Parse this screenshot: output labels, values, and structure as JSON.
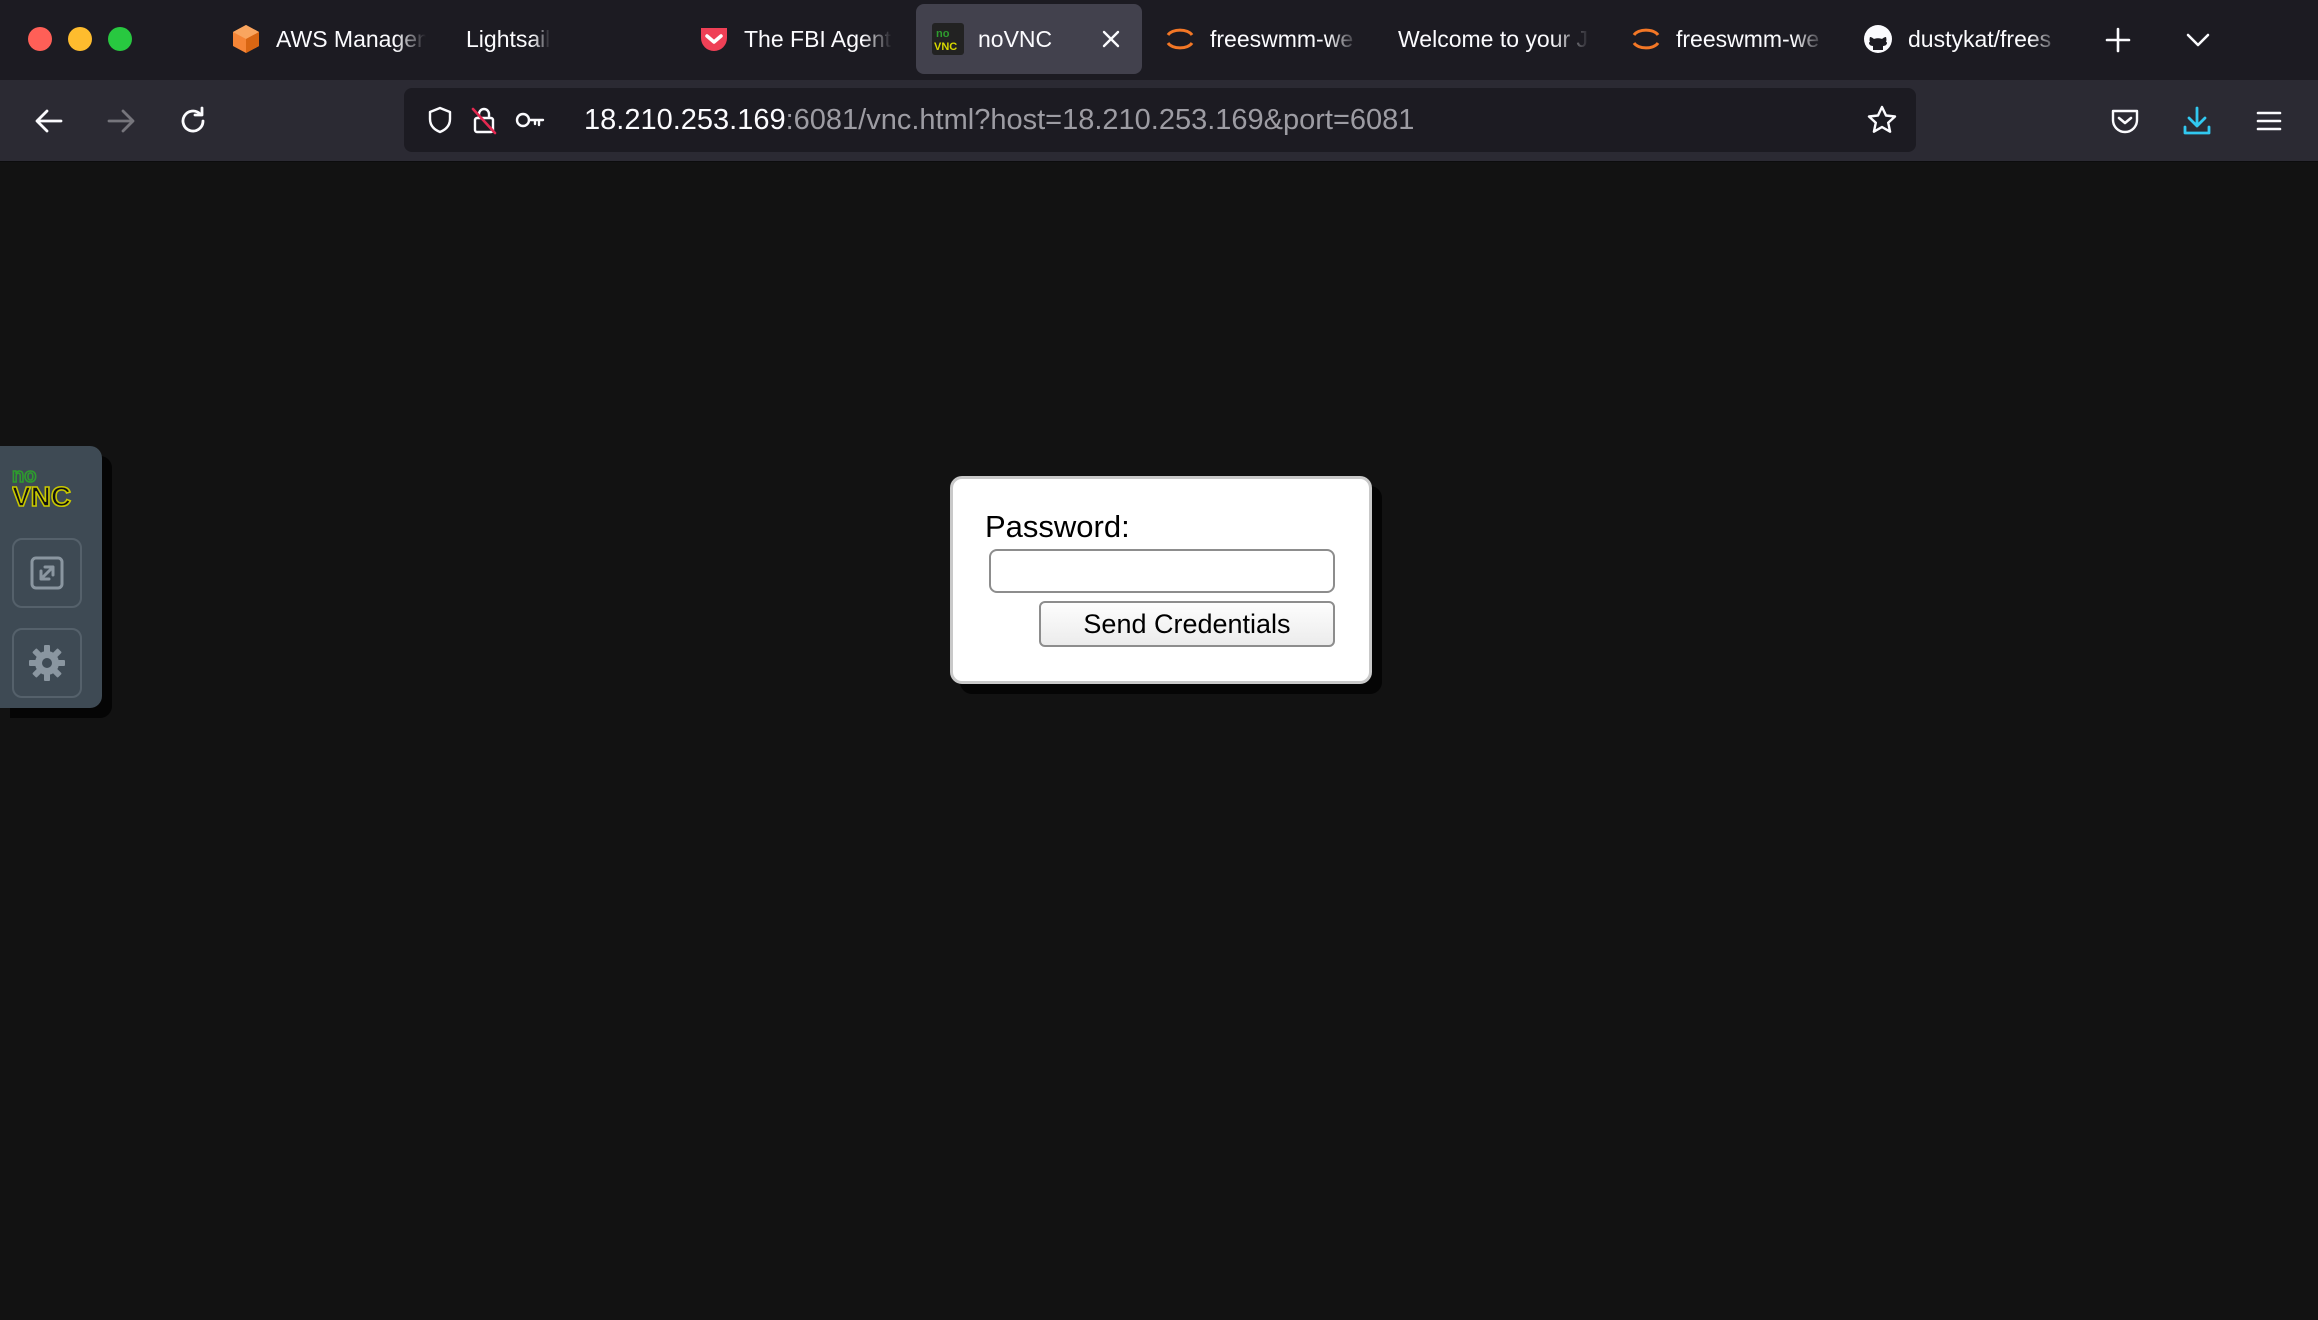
{
  "browser": {
    "tabs": [
      {
        "label": "AWS Managem",
        "favicon": "aws-cube-icon",
        "active": false
      },
      {
        "label": "Lightsail",
        "favicon": "",
        "active": false
      },
      {
        "label": "The FBI Agent",
        "favicon": "pocket-icon",
        "active": false
      },
      {
        "label": "noVNC",
        "favicon": "novnc-icon",
        "active": true
      },
      {
        "label": "freeswmm-we",
        "favicon": "jupyter-icon",
        "active": false
      },
      {
        "label": "Welcome to your J",
        "favicon": "",
        "active": false
      },
      {
        "label": "freeswmm-we",
        "favicon": "jupyter-icon",
        "active": false
      },
      {
        "label": "dustykat/frees",
        "favicon": "github-icon",
        "active": false
      }
    ],
    "url": {
      "host": "18.210.253.169",
      "rest": ":6081/vnc.html?host=18.210.253.169&port=6081"
    },
    "colors": {
      "accent": "#31c8f0",
      "tab_bg": "#1c1b22",
      "toolbar_bg": "#2b2a33"
    }
  },
  "novnc": {
    "logo_top": "no",
    "logo_bottom": "VNC",
    "colors": {
      "sidebar_bg": "#3e4a54",
      "logo_green": "#2e9b2e",
      "logo_yellow": "#c8c800"
    }
  },
  "credentials": {
    "password_label": "Password:",
    "password_value": "",
    "send_label": "Send Credentials"
  }
}
